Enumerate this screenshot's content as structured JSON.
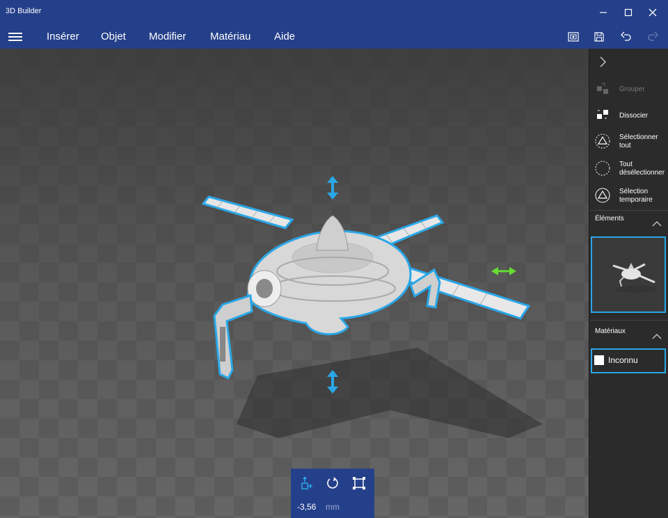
{
  "window": {
    "title": "3D Builder"
  },
  "menu": {
    "items": [
      "Insérer",
      "Objet",
      "Modifier",
      "Matériau",
      "Aide"
    ]
  },
  "panel": {
    "commands": [
      {
        "label": "Grouper",
        "enabled": false
      },
      {
        "label": "Dissocier",
        "enabled": true
      },
      {
        "label_line1": "Sélectionner",
        "label_line2": "tout"
      },
      {
        "label_line1": "Tout",
        "label_line2": "désélectionner"
      },
      {
        "label_line1": "Sélection",
        "label_line2": "temporaire"
      }
    ],
    "elements_header": "Éléments",
    "materials_header": "Matériaux",
    "material_name": "Inconnu"
  },
  "transform": {
    "value": "-3,56",
    "unit": "mm"
  },
  "colors": {
    "accent": "#25408a",
    "selection": "#2aa7e8",
    "gizmo_green": "#66dd33"
  }
}
